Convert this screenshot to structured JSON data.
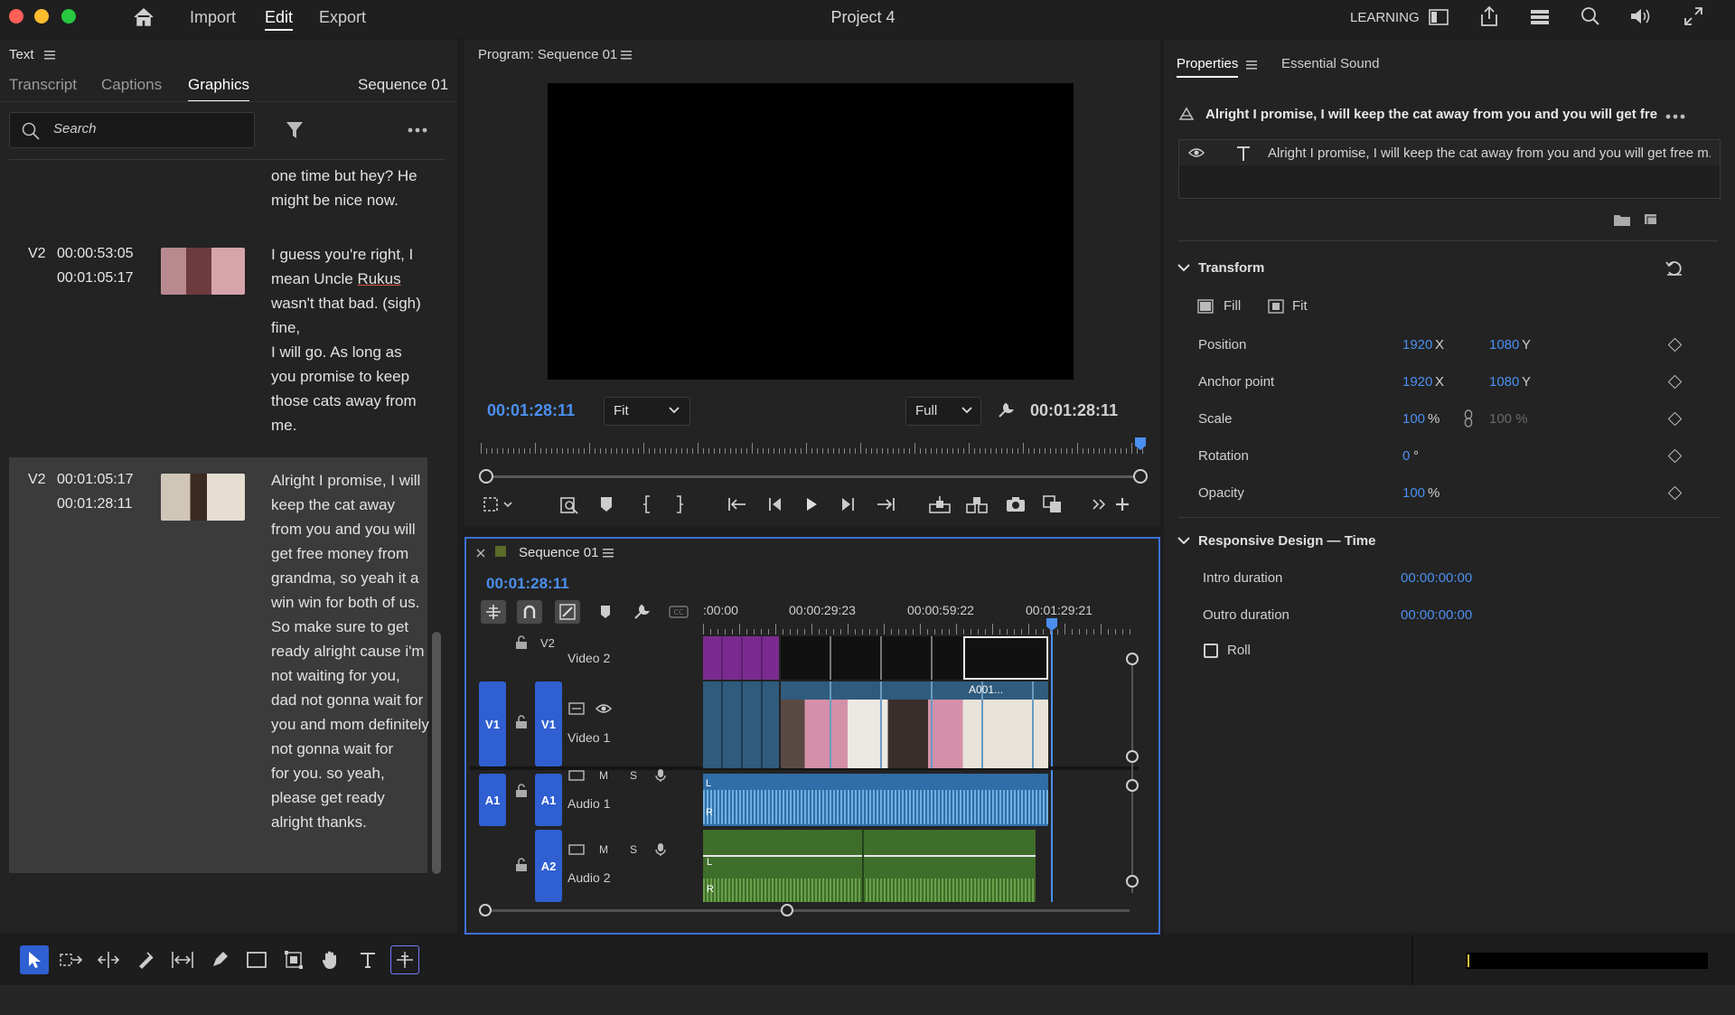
{
  "window": {
    "title": "Project 4",
    "menu": [
      "Import",
      "Edit",
      "Export"
    ],
    "workspace_label": "LEARNING"
  },
  "left_panel": {
    "panel_title": "Text",
    "tabs": [
      "Transcript",
      "Captions",
      "Graphics"
    ],
    "active_tab": "Graphics",
    "sequence_label": "Sequence 01",
    "search_placeholder": "Search",
    "rows": [
      {
        "track": "",
        "in": "",
        "out": "",
        "text": "one time but hey? He might be nice now."
      },
      {
        "track": "V2",
        "in": "00:00:53:05",
        "out": "00:01:05:17",
        "text_parts": [
          "I guess you're right, I mean Uncle ",
          "Rukus",
          " wasn't that bad. (sigh) fine,",
          "I will go. As long as you promise to keep those cats away from me."
        ]
      },
      {
        "track": "V2",
        "in": "00:01:05:17",
        "out": "00:01:28:11",
        "text_lines": [
          "Alright I promise, I will keep the cat away from you and you will get free money from grandma, so yeah it a win win for both of us. So make sure to get ready alright cause i'm not waiting for you, dad not gonna wait for you and mom definitely not gonna wait for",
          "for you. so yeah, please get ready alright thanks."
        ]
      }
    ]
  },
  "program_monitor": {
    "title": "Program: Sequence 01",
    "timecode_left": "00:01:28:11",
    "zoom_select": "Fit",
    "quality_select": "Full",
    "timecode_right": "00:01:28:11"
  },
  "timeline": {
    "sequence_name": "Sequence 01",
    "timecode": "00:01:28:11",
    "ruler_labels": [
      ":00:00",
      "00:00:29:23",
      "00:00:59:22",
      "00:01:29:21"
    ],
    "tracks": [
      {
        "id": "V2",
        "name": "Video 2"
      },
      {
        "src": "V1",
        "id": "V1",
        "name": "Video 1"
      },
      {
        "src": "A1",
        "id": "A1",
        "name": "Audio 1"
      },
      {
        "id": "A2",
        "name": "Audio 2"
      }
    ],
    "clip_label": "A001...",
    "track_buttons": {
      "mute": "M",
      "solo": "S"
    },
    "channel_labels": {
      "left": "L",
      "right": "R"
    }
  },
  "properties": {
    "tabs": [
      "Properties",
      "Essential Sound"
    ],
    "active_tab": "Properties",
    "selection_title": "Alright I promise, I will keep the cat away from you and you will  get free ...",
    "layer_text": "Alright I promise, I will keep the cat away from you and you will  get free m...",
    "transform": {
      "heading": "Transform",
      "fill_label": "Fill",
      "fit_label": "Fit",
      "position": {
        "label": "Position",
        "x": "1920",
        "y": "1080"
      },
      "anchor": {
        "label": "Anchor point",
        "x": "1920",
        "y": "1080"
      },
      "scale": {
        "label": "Scale",
        "value": "100",
        "unit": "%",
        "linked_value": "100 %"
      },
      "rotation": {
        "label": "Rotation",
        "value": "0",
        "unit": "°"
      },
      "opacity": {
        "label": "Opacity",
        "value": "100",
        "unit": "%"
      },
      "axis_x": "X",
      "axis_y": "Y"
    },
    "responsive": {
      "heading": "Responsive Design — Time",
      "intro_label": "Intro duration",
      "intro_value": "00:00:00:00",
      "outro_label": "Outro duration",
      "outro_value": "00:00:00:00",
      "roll_label": "Roll"
    }
  },
  "colors": {
    "accent_blue": "#4b8ff0",
    "track_button_blue": "#2f5fd1",
    "video_clip": "#2f5b7d",
    "graphics_clip": "#7a2b8f",
    "audio1_clip": "#2f6ea8",
    "audio2_clip": "#3f6e2a"
  }
}
